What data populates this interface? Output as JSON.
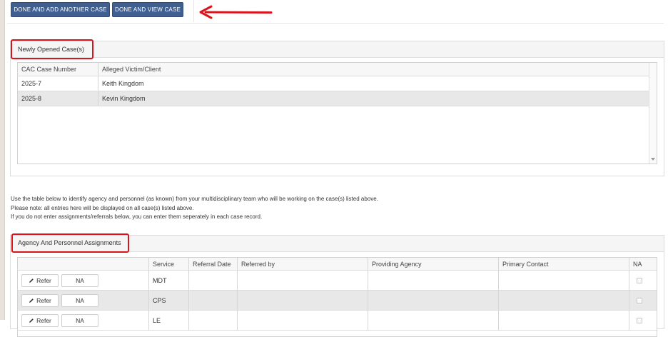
{
  "toolbar": {
    "done_add_label": "DONE AND ADD ANOTHER CASE",
    "done_view_label": "DONE AND VIEW CASE"
  },
  "annotation": {
    "arrow_color": "#d9141c"
  },
  "cases_panel": {
    "title": "Newly Opened Case(s)",
    "columns": [
      "CAC Case Number",
      "Alleged Victim/Client"
    ],
    "rows": [
      {
        "case_number": "2025-7",
        "client": "Keith Kingdom"
      },
      {
        "case_number": "2025-8",
        "client": "Kevin Kingdom"
      }
    ]
  },
  "instructions": [
    "Use the table below to identify agency and personnel (as known) from your multidisciplinary team who will be working on the case(s) listed above.",
    "Please note: all entries here will be displayed on all case(s) listed above.",
    "If you do not enter assignments/referrals below, you can enter them seperately in each case record."
  ],
  "assignments_panel": {
    "title": "Agency And Personnel Assignments",
    "columns": [
      "",
      "Service",
      "Referral Date",
      "Referred by",
      "Providing Agency",
      "Primary Contact",
      "NA"
    ],
    "refer_label": "Refer",
    "na_label": "NA",
    "rows": [
      {
        "service": "MDT"
      },
      {
        "service": "CPS"
      },
      {
        "service": "LE"
      }
    ]
  },
  "colors": {
    "primary_button": "#3f5f91",
    "highlight": "#d9141c"
  }
}
